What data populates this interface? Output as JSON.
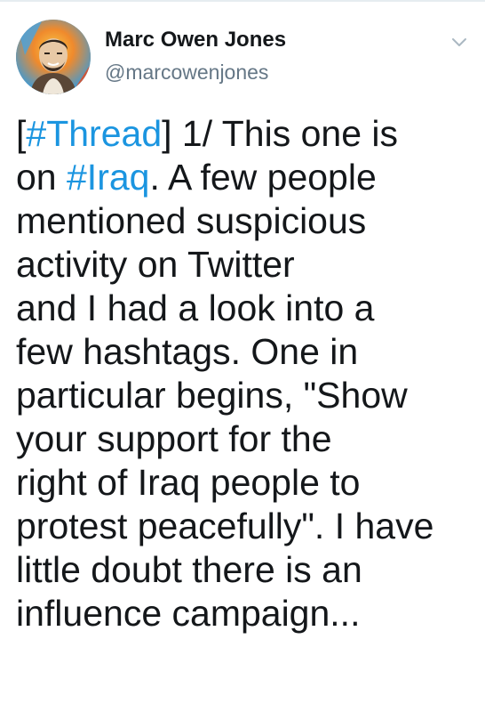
{
  "author": {
    "display_name": "Marc Owen Jones",
    "handle": "@marcowenjones",
    "avatar_icon": "user-avatar-icon"
  },
  "menu": {
    "icon": "chevron-down-icon"
  },
  "colors": {
    "link": "#1b95e0",
    "text": "#14171a",
    "secondary": "#657786"
  },
  "tweet": {
    "lines": [
      [
        {
          "t": "[",
          "tag": false
        },
        {
          "t": "#Thread",
          "tag": true
        },
        {
          "t": "] 1/ This one is",
          "tag": false
        }
      ],
      [
        {
          "t": "on ",
          "tag": false
        },
        {
          "t": "#Iraq",
          "tag": true
        },
        {
          "t": ". A few people",
          "tag": false
        }
      ],
      [
        {
          "t": "mentioned  suspicious",
          "tag": false
        }
      ],
      [
        {
          "t": "activity on Twitter",
          "tag": false
        }
      ],
      [
        {
          "t": "and I had a look into a",
          "tag": false
        }
      ],
      [
        {
          "t": "few hashtags. One in",
          "tag": false
        }
      ],
      [
        {
          "t": "particular begins, \"Show",
          "tag": false
        }
      ],
      [
        {
          "t": "your support for the",
          "tag": false
        }
      ],
      [
        {
          "t": "right of Iraq people to",
          "tag": false
        }
      ],
      [
        {
          "t": "protest peacefully\". I have",
          "tag": false
        }
      ],
      [
        {
          "t": "little doubt there is an",
          "tag": false
        }
      ],
      [
        {
          "t": "influence campaign...",
          "tag": false
        }
      ]
    ]
  }
}
